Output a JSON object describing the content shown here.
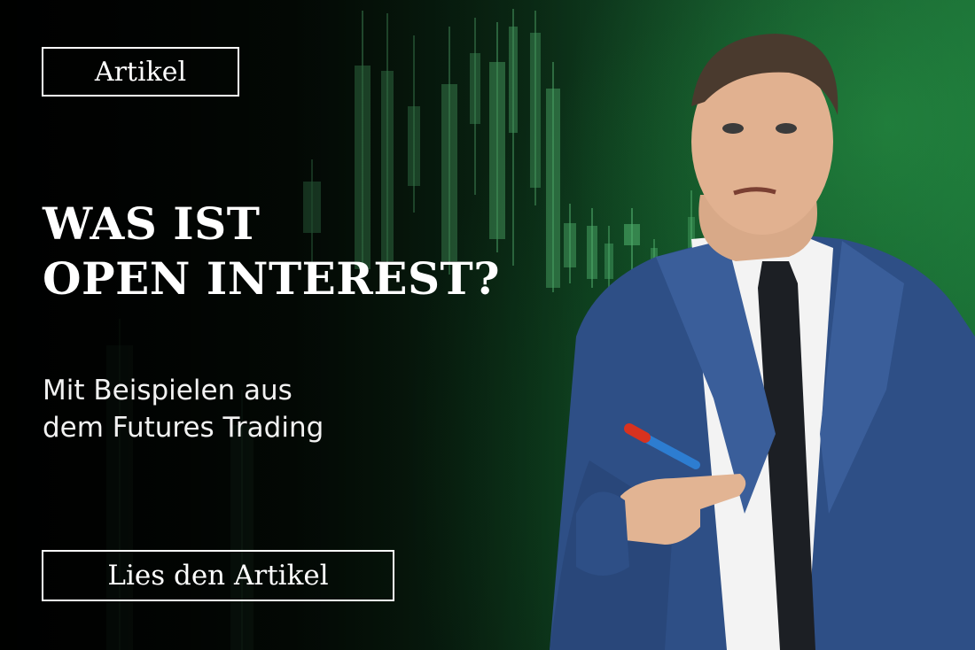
{
  "tag": {
    "label": "Artikel"
  },
  "headline": {
    "line1": "WAS IST",
    "line2": "OPEN INTEREST?"
  },
  "subheadline": {
    "line1": "Mit Beispielen aus",
    "line2": "dem Futures Trading"
  },
  "cta": {
    "label": "Lies den Artikel"
  },
  "colors": {
    "accent_green": "#1a6a34",
    "candle_green": "#3aa860",
    "text": "#ffffff"
  },
  "decor": {
    "background": "candlestick-chart",
    "photo": "presenter-in-suit-holding-marker"
  }
}
